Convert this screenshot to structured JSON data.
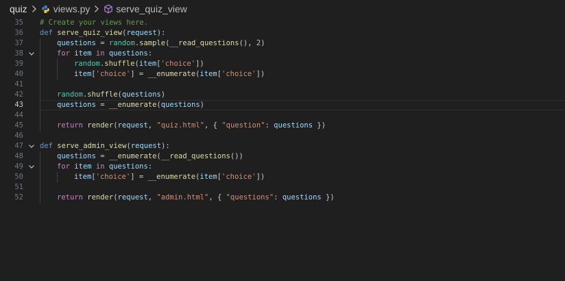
{
  "breadcrumb": {
    "folder": "quiz",
    "file": "views.py",
    "symbol": "serve_quiz_view"
  },
  "colors": {
    "background": "#1f1f1f",
    "keyword": "#569cd6",
    "control": "#c586c0",
    "function": "#dcdcaa",
    "variable": "#9cdcfe",
    "string": "#ce9178",
    "number": "#b5cea8",
    "comment": "#6a9955"
  },
  "editor": {
    "active_line": 43,
    "lines": [
      {
        "num": "35",
        "fold": "",
        "indent": 0,
        "tokens": [
          [
            "com",
            "# Create your views here."
          ]
        ]
      },
      {
        "num": "36",
        "fold": "",
        "indent": 0,
        "tokens": [
          [
            "kw",
            "def "
          ],
          [
            "fn",
            "serve_quiz_view"
          ],
          [
            "txt",
            "("
          ],
          [
            "var",
            "request"
          ],
          [
            "txt",
            "):"
          ]
        ]
      },
      {
        "num": "37",
        "fold": "",
        "indent": 1,
        "tokens": [
          [
            "var",
            "questions"
          ],
          [
            "txt",
            " = "
          ],
          [
            "mod",
            "random"
          ],
          [
            "txt",
            "."
          ],
          [
            "fn",
            "sample"
          ],
          [
            "txt",
            "("
          ],
          [
            "fn",
            "__read_questions"
          ],
          [
            "txt",
            "(), "
          ],
          [
            "num",
            "2"
          ],
          [
            "txt",
            ")"
          ]
        ]
      },
      {
        "num": "38",
        "fold": "open",
        "indent": 1,
        "tokens": [
          [
            "ctrl",
            "for "
          ],
          [
            "var",
            "item"
          ],
          [
            "ctrl",
            " in "
          ],
          [
            "var",
            "questions"
          ],
          [
            "txt",
            ":"
          ]
        ]
      },
      {
        "num": "39",
        "fold": "",
        "indent": 2,
        "tokens": [
          [
            "mod",
            "random"
          ],
          [
            "txt",
            "."
          ],
          [
            "fn",
            "shuffle"
          ],
          [
            "txt",
            "("
          ],
          [
            "var",
            "item"
          ],
          [
            "txt",
            "["
          ],
          [
            "str",
            "'choice'"
          ],
          [
            "txt",
            "])"
          ]
        ]
      },
      {
        "num": "40",
        "fold": "",
        "indent": 2,
        "tokens": [
          [
            "var",
            "item"
          ],
          [
            "txt",
            "["
          ],
          [
            "str",
            "'choice'"
          ],
          [
            "txt",
            "] = "
          ],
          [
            "fn",
            "__enumerate"
          ],
          [
            "txt",
            "("
          ],
          [
            "var",
            "item"
          ],
          [
            "txt",
            "["
          ],
          [
            "str",
            "'choice'"
          ],
          [
            "txt",
            "])"
          ]
        ]
      },
      {
        "num": "41",
        "fold": "",
        "indent": 1,
        "tokens": []
      },
      {
        "num": "42",
        "fold": "",
        "indent": 1,
        "tokens": [
          [
            "mod",
            "random"
          ],
          [
            "txt",
            "."
          ],
          [
            "fn",
            "shuffle"
          ],
          [
            "txt",
            "("
          ],
          [
            "var",
            "questions"
          ],
          [
            "txt",
            ")"
          ]
        ]
      },
      {
        "num": "43",
        "fold": "",
        "indent": 1,
        "tokens": [
          [
            "var",
            "questions"
          ],
          [
            "txt",
            " = "
          ],
          [
            "fn",
            "__enumerate"
          ],
          [
            "txt",
            "("
          ],
          [
            "var",
            "questions"
          ],
          [
            "txt",
            ")"
          ]
        ]
      },
      {
        "num": "44",
        "fold": "",
        "indent": 1,
        "tokens": []
      },
      {
        "num": "45",
        "fold": "",
        "indent": 1,
        "tokens": [
          [
            "ctrl",
            "return "
          ],
          [
            "fn",
            "render"
          ],
          [
            "txt",
            "("
          ],
          [
            "var",
            "request"
          ],
          [
            "txt",
            ", "
          ],
          [
            "str",
            "\"quiz.html\""
          ],
          [
            "txt",
            ", { "
          ],
          [
            "str",
            "\"question\""
          ],
          [
            "txt",
            ": "
          ],
          [
            "var",
            "questions"
          ],
          [
            "txt",
            " })"
          ]
        ]
      },
      {
        "num": "46",
        "fold": "",
        "indent": 0,
        "tokens": []
      },
      {
        "num": "47",
        "fold": "open",
        "indent": 0,
        "tokens": [
          [
            "kw",
            "def "
          ],
          [
            "fn",
            "serve_admin_view"
          ],
          [
            "txt",
            "("
          ],
          [
            "var",
            "request"
          ],
          [
            "txt",
            "):"
          ]
        ]
      },
      {
        "num": "48",
        "fold": "",
        "indent": 1,
        "tokens": [
          [
            "var",
            "questions"
          ],
          [
            "txt",
            " = "
          ],
          [
            "fn",
            "__enumerate"
          ],
          [
            "txt",
            "("
          ],
          [
            "fn",
            "__read_questions"
          ],
          [
            "txt",
            "())"
          ]
        ]
      },
      {
        "num": "49",
        "fold": "open",
        "indent": 1,
        "tokens": [
          [
            "ctrl",
            "for "
          ],
          [
            "var",
            "item"
          ],
          [
            "ctrl",
            " in "
          ],
          [
            "var",
            "questions"
          ],
          [
            "txt",
            ":"
          ]
        ]
      },
      {
        "num": "50",
        "fold": "",
        "indent": 2,
        "tokens": [
          [
            "var",
            "item"
          ],
          [
            "txt",
            "["
          ],
          [
            "str",
            "'choice'"
          ],
          [
            "txt",
            "] = "
          ],
          [
            "fn",
            "__enumerate"
          ],
          [
            "txt",
            "("
          ],
          [
            "var",
            "item"
          ],
          [
            "txt",
            "["
          ],
          [
            "str",
            "'choice'"
          ],
          [
            "txt",
            "])"
          ]
        ]
      },
      {
        "num": "51",
        "fold": "",
        "indent": 1,
        "tokens": []
      },
      {
        "num": "52",
        "fold": "",
        "indent": 1,
        "tokens": [
          [
            "ctrl",
            "return "
          ],
          [
            "fn",
            "render"
          ],
          [
            "txt",
            "("
          ],
          [
            "var",
            "request"
          ],
          [
            "txt",
            ", "
          ],
          [
            "str",
            "\"admin.html\""
          ],
          [
            "txt",
            ", { "
          ],
          [
            "str",
            "\"questions\""
          ],
          [
            "txt",
            ": "
          ],
          [
            "var",
            "questions"
          ],
          [
            "txt",
            " })"
          ]
        ]
      }
    ]
  }
}
